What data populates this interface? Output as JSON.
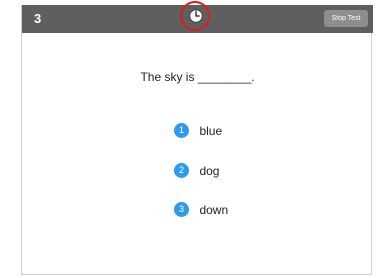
{
  "header": {
    "question_number": "3",
    "timer_icon": "clock-icon",
    "stop_button_label": "Stop Test"
  },
  "question": {
    "text": "The sky is ________."
  },
  "options": [
    {
      "number": "1",
      "label": "blue"
    },
    {
      "number": "2",
      "label": "dog"
    },
    {
      "number": "3",
      "label": "down"
    }
  ],
  "colors": {
    "header_bar": "#5f5f5f",
    "option_badge": "#2f9be8",
    "timer_highlight": "#d81d1d",
    "stop_button": "#8e8e8e"
  }
}
